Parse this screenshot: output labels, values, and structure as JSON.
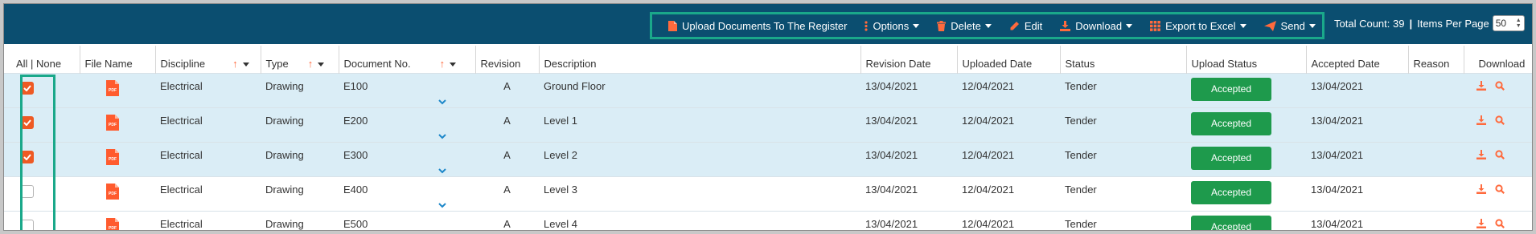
{
  "toolbar": {
    "upload": "Upload Documents To The Register",
    "options": "Options",
    "delete": "Delete",
    "edit": "Edit",
    "download": "Download",
    "export": "Export to Excel",
    "send": "Send"
  },
  "info": {
    "total_count": "Total Count: 39",
    "sep": "|",
    "items_per_page_label": "Items Per Page",
    "items_per_page": "50"
  },
  "colors": {
    "header_bg": "#0b4e70",
    "accent": "#ee5a24",
    "highlight": "#1aa88a",
    "accepted": "#1e9a4c",
    "selected_row": "#daedf6"
  },
  "columns": {
    "all_none": "All | None",
    "file_name": "File Name",
    "discipline": "Discipline",
    "type": "Type",
    "document_no": "Document No.",
    "revision": "Revision",
    "description": "Description",
    "revision_date": "Revision Date",
    "uploaded_date": "Uploaded Date",
    "status": "Status",
    "upload_status": "Upload Status",
    "accepted_date": "Accepted Date",
    "reason": "Reason",
    "download": "Download"
  },
  "rows": [
    {
      "checked": true,
      "discipline": "Electrical",
      "type": "Drawing",
      "doc_no": "E100",
      "revision": "A",
      "description": "Ground Floor",
      "revision_date": "13/04/2021",
      "uploaded_date": "12/04/2021",
      "status": "Tender",
      "upload_status": "Accepted",
      "accepted_date": "13/04/2021",
      "reason": ""
    },
    {
      "checked": true,
      "discipline": "Electrical",
      "type": "Drawing",
      "doc_no": "E200",
      "revision": "A",
      "description": "Level 1",
      "revision_date": "13/04/2021",
      "uploaded_date": "12/04/2021",
      "status": "Tender",
      "upload_status": "Accepted",
      "accepted_date": "13/04/2021",
      "reason": ""
    },
    {
      "checked": true,
      "discipline": "Electrical",
      "type": "Drawing",
      "doc_no": "E300",
      "revision": "A",
      "description": "Level 2",
      "revision_date": "13/04/2021",
      "uploaded_date": "12/04/2021",
      "status": "Tender",
      "upload_status": "Accepted",
      "accepted_date": "13/04/2021",
      "reason": ""
    },
    {
      "checked": false,
      "discipline": "Electrical",
      "type": "Drawing",
      "doc_no": "E400",
      "revision": "A",
      "description": "Level 3",
      "revision_date": "13/04/2021",
      "uploaded_date": "12/04/2021",
      "status": "Tender",
      "upload_status": "Accepted",
      "accepted_date": "13/04/2021",
      "reason": ""
    },
    {
      "checked": false,
      "discipline": "Electrical",
      "type": "Drawing",
      "doc_no": "E500",
      "revision": "A",
      "description": "Level 4",
      "revision_date": "13/04/2021",
      "uploaded_date": "12/04/2021",
      "status": "Tender",
      "upload_status": "Accepted",
      "accepted_date": "13/04/2021",
      "reason": ""
    }
  ]
}
